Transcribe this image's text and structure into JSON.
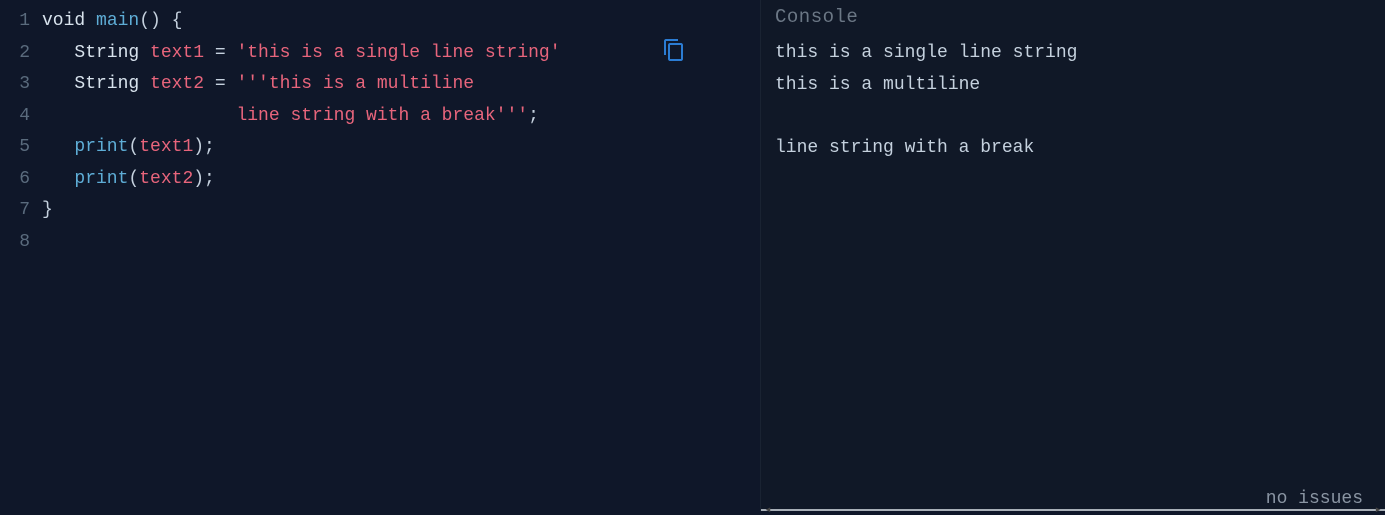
{
  "editor": {
    "lines": [
      {
        "num": "1",
        "tokens": [
          {
            "cls": "kw",
            "t": "void"
          },
          {
            "cls": "op",
            "t": " "
          },
          {
            "cls": "func",
            "t": "main"
          },
          {
            "cls": "punct",
            "t": "() {"
          }
        ]
      },
      {
        "num": "2",
        "tokens": [
          {
            "cls": "op",
            "t": "   "
          },
          {
            "cls": "type",
            "t": "String"
          },
          {
            "cls": "op",
            "t": " "
          },
          {
            "cls": "ident",
            "t": "text1"
          },
          {
            "cls": "op",
            "t": " = "
          },
          {
            "cls": "str",
            "t": "'this is a single line string'"
          }
        ]
      },
      {
        "num": "3",
        "tokens": [
          {
            "cls": "op",
            "t": "   "
          },
          {
            "cls": "type",
            "t": "String"
          },
          {
            "cls": "op",
            "t": " "
          },
          {
            "cls": "ident",
            "t": "text2"
          },
          {
            "cls": "op",
            "t": " = "
          },
          {
            "cls": "str",
            "t": "'''this is a multiline"
          }
        ]
      },
      {
        "num": "4",
        "tokens": [
          {
            "cls": "op",
            "t": "                  "
          },
          {
            "cls": "str",
            "t": "line string with a break'''"
          },
          {
            "cls": "punct",
            "t": ";"
          }
        ]
      },
      {
        "num": "5",
        "tokens": [
          {
            "cls": "op",
            "t": "   "
          },
          {
            "cls": "func",
            "t": "print"
          },
          {
            "cls": "punct",
            "t": "("
          },
          {
            "cls": "ident",
            "t": "text1"
          },
          {
            "cls": "punct",
            "t": ");"
          }
        ]
      },
      {
        "num": "6",
        "tokens": [
          {
            "cls": "op",
            "t": "   "
          },
          {
            "cls": "func",
            "t": "print"
          },
          {
            "cls": "punct",
            "t": "("
          },
          {
            "cls": "ident",
            "t": "text2"
          },
          {
            "cls": "punct",
            "t": ");"
          }
        ]
      },
      {
        "num": "7",
        "tokens": [
          {
            "cls": "punct",
            "t": "}"
          }
        ]
      },
      {
        "num": "8",
        "tokens": []
      }
    ]
  },
  "console": {
    "title": "Console",
    "output": "this is a single line string\nthis is a multiline\n\nline string with a break"
  },
  "status": {
    "text": "no issues"
  }
}
